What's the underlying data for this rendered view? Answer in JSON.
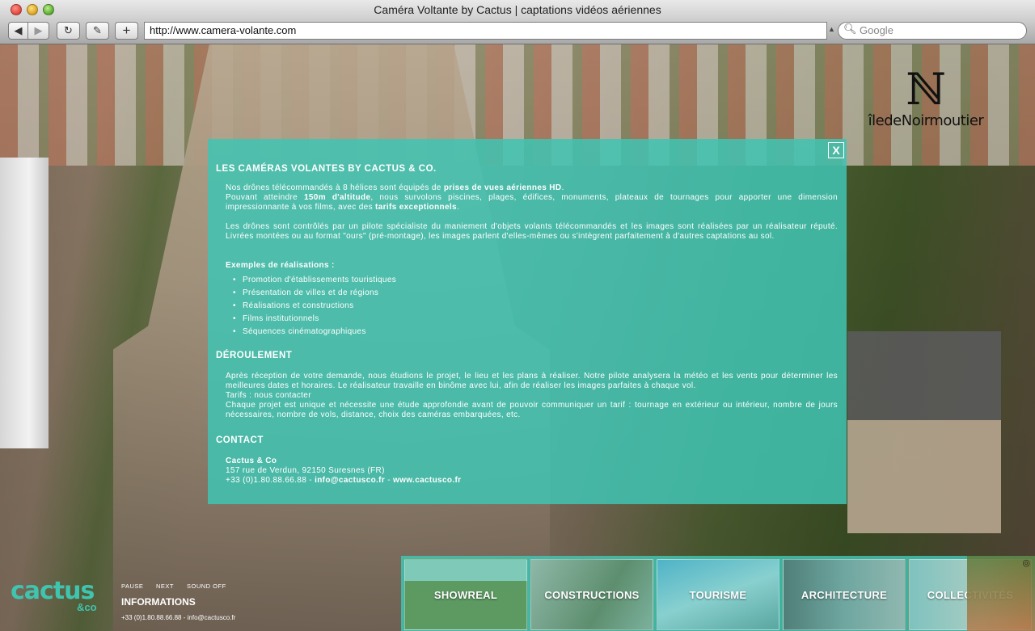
{
  "browser": {
    "window_title": "Caméra Voltante by Cactus | captations vidéos aériennes",
    "url": "http://www.camera-volante.com",
    "search_placeholder": "Google",
    "back_label": "◀",
    "forward_label": "▶",
    "reload_label": "↻",
    "snapshot_label": "✎",
    "add_label": "+"
  },
  "logo_overlay": {
    "text": "îledeNoirmoutier"
  },
  "panel": {
    "close_label": "X",
    "section1_title": "LES CAMÉRAS VOLANTES BY CACTUS & CO.",
    "p1_a": "Nos drônes télécommandés à 8 hélices sont équipés de ",
    "p1_b": "prises de vues aériennes HD",
    "p1_c": ".",
    "p2_a": "Pouvant atteindre ",
    "p2_b": "150m d'altitude",
    "p2_c": ", nous survolons piscines, plages, édifices, monuments, plateaux de tournages pour apporter une dimension impressionnante à vos films, avec des ",
    "p2_d": "tarifs exceptionnels",
    "p2_e": ".",
    "p3": "Les drônes sont contrôlés par un pilote spécialiste du maniement d'objets volants télécommandés et les images sont réalisées par un réalisateur réputé. Livrées montées ou au format \"ours\" (pré-montage), les images parlent d'elles-mêmes ou s'intègrent parfaitement à d'autres captations au sol.",
    "examples_title": "Exemples de réalisations :",
    "examples": [
      "Promotion d'établissements touristiques",
      "Présentation de villes et de régions",
      "Réalisations et constructions",
      "Films institutionnels",
      "Séquences cinématographiques"
    ],
    "section2_title": "DÉROULEMENT",
    "d1": "Après réception de votre demande, nous étudions le projet, le lieu et les plans à réaliser. Notre pilote analysera la météo et les vents pour déterminer les meilleures dates et horaires. Le réalisateur travaille en binôme avec lui, afin de réaliser les images parfaites à chaque vol.",
    "d2": "Tarifs : nous contacter",
    "d3": "Chaque projet est unique et nécessite une étude approfondie avant de pouvoir communiquer un tarif : tournage en extérieur ou intérieur, nombre de jours nécessaires, nombre de vols, distance, choix des caméras embarquées, etc.",
    "section3_title": "CONTACT",
    "company": "Cactus & Co",
    "address": "157 rue de Verdun, 92150 Suresnes (FR)",
    "phone": "+33 (0)1.80.88.66.88 - ",
    "email": "info@cactusco.fr",
    "sep": " - ",
    "website": "www.cactusco.fr"
  },
  "footer": {
    "logo": "cactus",
    "logo_co": "&co",
    "pause": "PAUSE",
    "next": "NEXT",
    "sound": "SOUND OFF",
    "info_title": "INFORMATIONS",
    "info_line": "+33 (0)1.80.88.66.88  -  info@cactusco.fr"
  },
  "nav": {
    "items": [
      "SHOWREAL",
      "CONSTRUCTIONS",
      "TOURISME",
      "ARCHITECTURE",
      "COLLECTIVITÉS"
    ]
  },
  "colors": {
    "accent": "#40c4b2",
    "panel_text": "#ffffff"
  }
}
